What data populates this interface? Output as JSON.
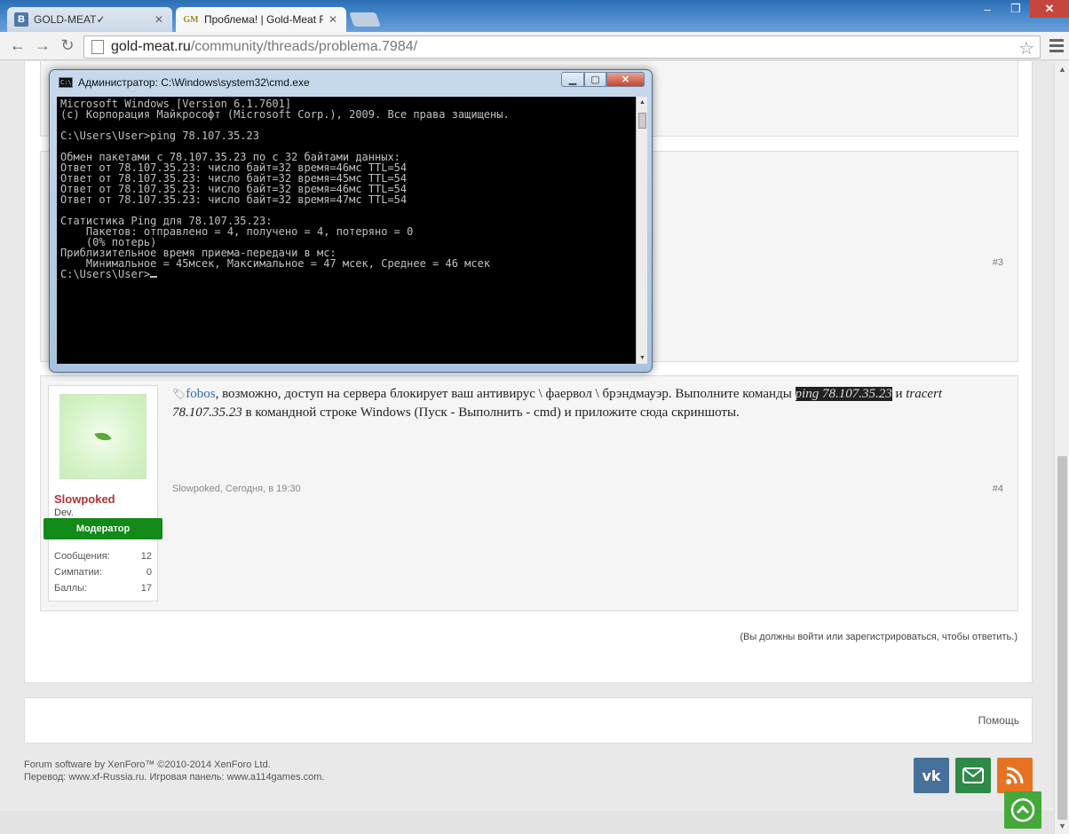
{
  "browser": {
    "tabs": [
      {
        "label": "GOLD-MEAT✓",
        "favicon": "B"
      },
      {
        "label": "Проблема! | Gold-Meat F",
        "favicon": "GM"
      }
    ],
    "url_host": "gold-meat.ru",
    "url_path": "/community/threads/problema.7984/"
  },
  "posts": {
    "p3_number": "#3",
    "p4": {
      "number": "#4",
      "mention": "fobos",
      "text_part1": ", возможно, доступ на сервера блокирует ваш антивирус \\ фаервол \\ брэндмауэр. Выполните команды ",
      "cmd_ping": "ping 78.107.35.23",
      "text_part2": " и ",
      "cmd_tracert": "tracert 78.107.35.23",
      "text_part3": " в командной строке Windows (Пуск - Выполнить - cmd) и приложите сюда скриншоты.",
      "meta": "Slowpoked, Сегодня, в 19:30",
      "author": {
        "name": "Slowpoked",
        "title": "Dev.",
        "badge": "Модератор",
        "stats": [
          {
            "label": "Сообщения:",
            "value": "12"
          },
          {
            "label": "Симпатии:",
            "value": "0"
          },
          {
            "label": "Баллы:",
            "value": "17"
          }
        ]
      }
    }
  },
  "reply_note": "(Вы должны войти или зарегистрироваться, чтобы ответить.)",
  "footer": {
    "help": "Помощь",
    "copyright_line1": "Forum software by XenForo™ ©2010-2014 XenForo Ltd.",
    "copyright_line2": "Перевод: www.xf-Russia.ru. Игровая панель: www.a114games.com.",
    "social": {
      "vk": "vk"
    }
  },
  "cmd": {
    "title": "Администратор: C:\\Windows\\system32\\cmd.exe",
    "icon_text": "C:\\",
    "lines": [
      "Microsoft Windows [Version 6.1.7601]",
      "(c) Корпорация Майкрософт (Microsoft Corp.), 2009. Все права защищены.",
      "",
      "C:\\Users\\User>ping 78.107.35.23",
      "",
      "Обмен пакетами с 78.107.35.23 по с 32 байтами данных:",
      "Ответ от 78.107.35.23: число байт=32 время=46мс TTL=54",
      "Ответ от 78.107.35.23: число байт=32 время=45мс TTL=54",
      "Ответ от 78.107.35.23: число байт=32 время=46мс TTL=54",
      "Ответ от 78.107.35.23: число байт=32 время=47мс TTL=54",
      "",
      "Статистика Ping для 78.107.35.23:",
      "    Пакетов: отправлено = 4, получено = 4, потеряно = 0",
      "    (0% потерь)",
      "Приблизительное время приема-передачи в мс:",
      "    Минимальное = 45мсек, Максимальное = 47 мсек, Среднее = 46 мсек",
      ""
    ],
    "prompt": "C:\\Users\\User>"
  }
}
